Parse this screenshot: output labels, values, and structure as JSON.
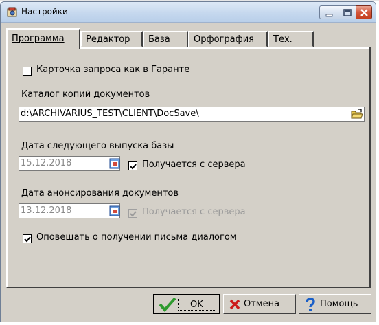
{
  "window": {
    "title": "Настройки",
    "icon": "settings-app-icon",
    "controls": [
      "minimize-icon",
      "maximize-icon",
      "close-icon"
    ]
  },
  "tabs": [
    {
      "label": "Программа",
      "active": true
    },
    {
      "label": "Редактор",
      "active": false
    },
    {
      "label": "База",
      "active": false
    },
    {
      "label": "Орфография",
      "active": false
    },
    {
      "label": "Тех.",
      "active": false
    }
  ],
  "program": {
    "garant_card": {
      "label": "Карточка запроса как в Гаранте",
      "checked": false
    },
    "copies_dir": {
      "label": "Каталог копий документов",
      "value": "d:\\ARCHIVARIUS_TEST\\CLIENT\\DocSave\\",
      "browse_icon": "open-folder-icon"
    },
    "next_release": {
      "label": "Дата следующего выпуска базы",
      "value": "15.12.2018",
      "calendar_icon": "calendar-icon",
      "from_server": {
        "label": "Получается с сервера",
        "checked": true,
        "enabled": true
      }
    },
    "announce_date": {
      "label": "Дата анонсирования документов",
      "value": "13.12.2018",
      "calendar_icon": "calendar-icon",
      "from_server": {
        "label": "Получается с сервера",
        "checked": true,
        "enabled": false
      }
    },
    "notify_dialog": {
      "label": "Оповещать о получении письма диалогом",
      "checked": true
    }
  },
  "buttons": {
    "ok": {
      "label": "OK",
      "icon": "checkmark-icon"
    },
    "cancel": {
      "label": "Отмена",
      "icon": "red-x-icon"
    },
    "help": {
      "label": "Помощь",
      "icon": "question-icon"
    }
  },
  "colors": {
    "dialog_bg": "#d4d0c8",
    "titlebar": "#c6d8ee",
    "close_button": "#c5401f",
    "ok_check": "#2e9a2e",
    "cancel_x": "#cc1a1a",
    "help_q": "#1a5fc8"
  }
}
